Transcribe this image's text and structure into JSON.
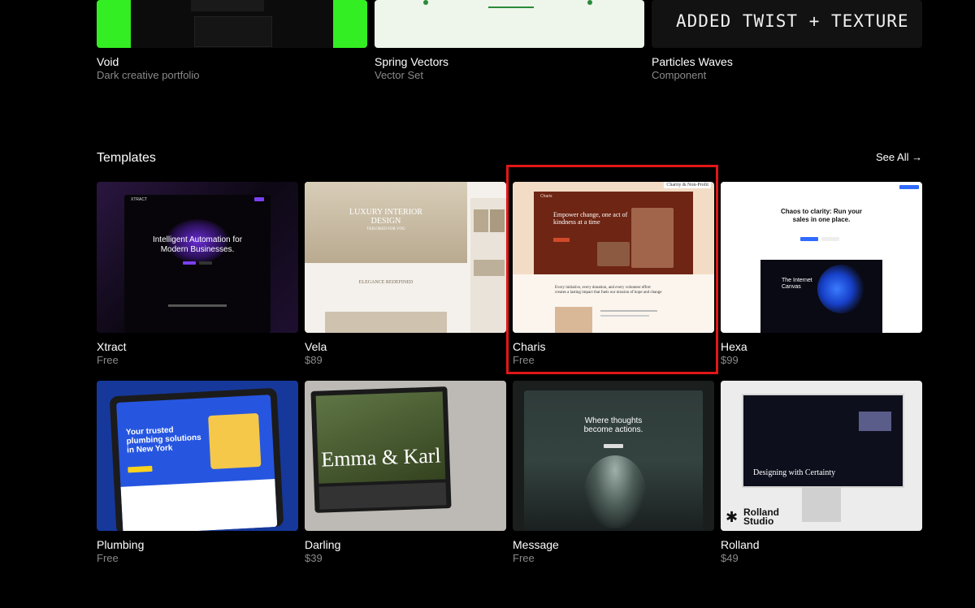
{
  "top_row": [
    {
      "title": "Void",
      "subtitle": "Dark creative portfolio"
    },
    {
      "title": "Spring Vectors",
      "subtitle": "Vector Set"
    },
    {
      "title": "Particles Waves",
      "subtitle": "Component",
      "thumb_text": "ADDED TWIST + TEXTURE"
    }
  ],
  "templates_section": {
    "title": "Templates",
    "see_all": "See All →"
  },
  "templates": [
    {
      "title": "Xtract",
      "price": "Free",
      "thumb": {
        "brand": "XTRACT",
        "headline": "Intelligent Automation for Modern Businesses."
      }
    },
    {
      "title": "Vela",
      "price": "$89",
      "thumb": {
        "headline": "LUXURY INTERIOR DESIGN",
        "tagline": "TAILORED FOR YOU",
        "section": "ELEGANCE REDEFINED"
      }
    },
    {
      "title": "Charis",
      "price": "Free",
      "thumb": {
        "tag": "Charity & Non-Profit",
        "brand": "Charis",
        "headline": "Empower change, one act of kindness at a time",
        "body": "Every initiative, every donation, and every volunteer effort creates a lasting impact that fuels our mission of hope and change"
      }
    },
    {
      "title": "Hexa",
      "price": "$99",
      "thumb": {
        "headline": "Chaos to clarity: Run your sales in one place.",
        "card_text": "The Internet Canvas"
      }
    },
    {
      "title": "Plumbing",
      "price": "Free",
      "thumb": {
        "headline": "Your trusted plumbing solutions in New York"
      }
    },
    {
      "title": "Darling",
      "price": "$39",
      "thumb": {
        "headline": "Emma & Karl"
      }
    },
    {
      "title": "Message",
      "price": "Free",
      "thumb": {
        "headline": "Where thoughts become actions."
      }
    },
    {
      "title": "Rolland",
      "price": "$49",
      "thumb": {
        "headline": "Designing with Certainty",
        "brand": "Rolland Studio"
      }
    }
  ],
  "colors": {
    "highlight": "#e11717",
    "background": "#000000"
  }
}
